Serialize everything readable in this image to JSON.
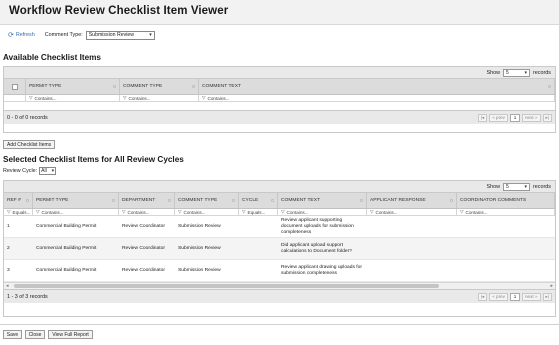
{
  "page": {
    "title": "Workflow Review Checklist Item Viewer"
  },
  "toolbar": {
    "refresh_label": "Refresh",
    "comment_type_label": "Comment Type:",
    "comment_type_value": "Submission Review"
  },
  "available": {
    "title": "Available Checklist Items",
    "show_label": "Show",
    "show_value": "5",
    "records_label": "records",
    "columns": [
      "PERMIT TYPE",
      "COMMENT TYPE",
      "COMMENT TEXT"
    ],
    "filters": [
      "Contains...",
      "Contains...",
      "Contains..."
    ],
    "footer": "0 - 0 of 0 records",
    "pager": {
      "prev": "« prev",
      "page": "1",
      "next": "next »"
    },
    "add_button": "Add Checklist Items"
  },
  "selected": {
    "title": "Selected Checklist Items for All Review Cycles",
    "review_cycle_label": "Review Cycle:",
    "review_cycle_value": "All",
    "show_label": "Show",
    "show_value": "5",
    "records_label": "records",
    "columns": [
      "REF #",
      "PERMIT TYPE",
      "DEPARTMENT",
      "COMMENT TYPE",
      "CYCLE",
      "COMMENT TEXT",
      "APPLICANT RESPONSE",
      "COORDINATOR COMMENTS"
    ],
    "filters": [
      "Equals...",
      "Contains...",
      "Contains...",
      "Contains...",
      "Equals...",
      "Contains...",
      "Contains...",
      "Contains..."
    ],
    "rows": [
      {
        "ref": "1",
        "permit": "Commercial Building Permit",
        "dept": "Review Coordinator",
        "ctype": "Submission Review",
        "cycle": "",
        "text": "Review applicant supporting document uploads for submission completeness",
        "response": "",
        "coord": ""
      },
      {
        "ref": "2",
        "permit": "Commercial Building Permit",
        "dept": "Review Coordinator",
        "ctype": "Submission Review",
        "cycle": "",
        "text": "Did applicant upload support calculations to Document folder?",
        "response": "",
        "coord": ""
      },
      {
        "ref": "3",
        "permit": "Commercial Building Permit",
        "dept": "Review Coordinator",
        "ctype": "Submission Review",
        "cycle": "",
        "text": "Review applicant drawing uploads for submission completeness",
        "response": "",
        "coord": ""
      }
    ],
    "footer": "1 - 3 of 3 records",
    "pager": {
      "prev": "« prev",
      "page": "1",
      "next": "next »"
    }
  },
  "footer_buttons": {
    "save": "Save",
    "close": "Close",
    "full_report": "View Full Report"
  }
}
